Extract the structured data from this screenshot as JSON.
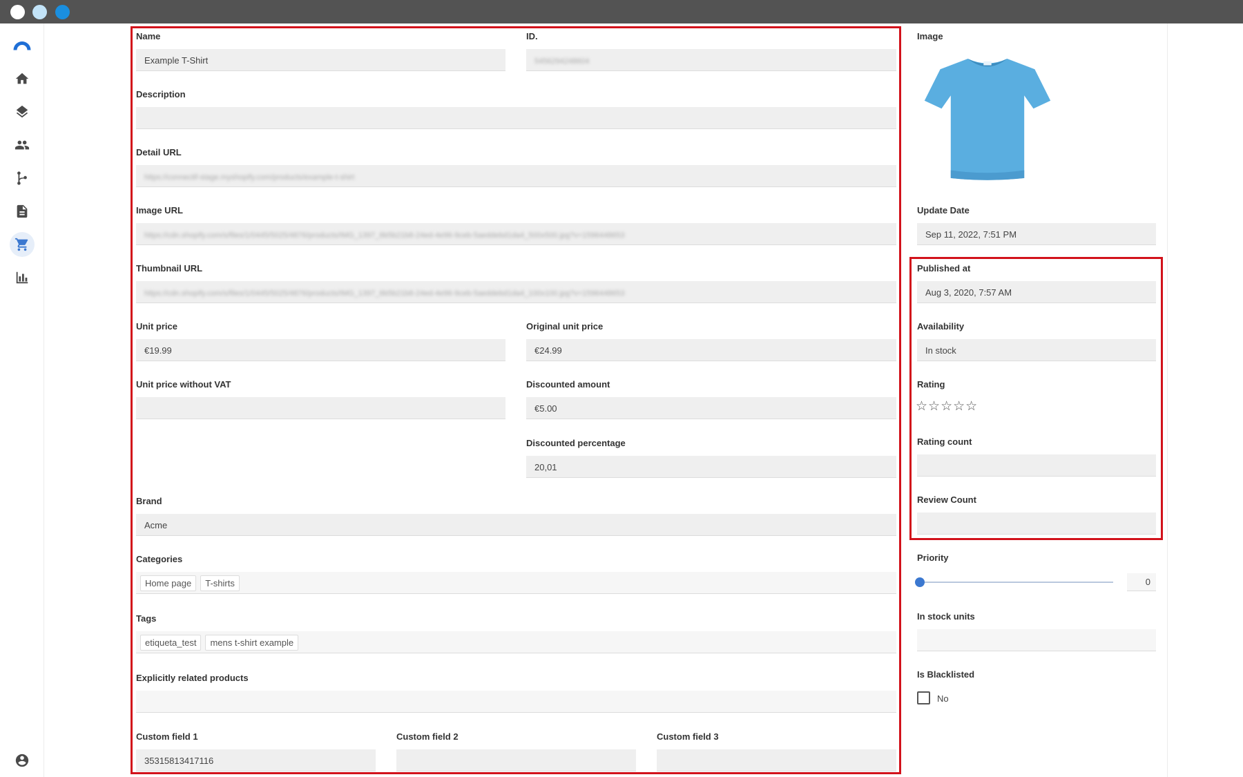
{
  "window": {
    "colors": {
      "titlebar": "#535353",
      "accent": "#3b78d0",
      "highlight": "#d2121b"
    }
  },
  "sidebar": {
    "items": [
      {
        "name": "logo",
        "icon": "brand-logo"
      },
      {
        "name": "home",
        "icon": "home-icon"
      },
      {
        "name": "layers",
        "icon": "layers-icon"
      },
      {
        "name": "contacts",
        "icon": "people-icon"
      },
      {
        "name": "flows",
        "icon": "branch-icon"
      },
      {
        "name": "documents",
        "icon": "document-icon"
      },
      {
        "name": "products",
        "icon": "cart-icon",
        "active": true
      },
      {
        "name": "analytics",
        "icon": "bar-chart-icon"
      },
      {
        "name": "account",
        "icon": "account-icon"
      }
    ]
  },
  "form": {
    "name": {
      "label": "Name",
      "value": "Example T-Shirt"
    },
    "id": {
      "label": "ID.",
      "value": "5456294248604"
    },
    "description": {
      "label": "Description",
      "value": ""
    },
    "detail_url": {
      "label": "Detail URL",
      "value": "https://connectif-stage.myshopify.com/products/example-t-shirt"
    },
    "image_url": {
      "label": "Image URL",
      "value": "https://cdn.shopify.com/s/files/1/0445/5025/4876/products/IMG_1397_6b5b21b8-24ed-4e96-9ceb-5aeddebd1da4_500x500.jpg?v=1596448653"
    },
    "thumbnail_url": {
      "label": "Thumbnail URL",
      "value": "https://cdn.shopify.com/s/files/1/0445/5025/4876/products/IMG_1397_6b5b21b8-24ed-4e96-9ceb-5aeddebd1da4_100x100.jpg?v=1596448653"
    },
    "unit_price": {
      "label": "Unit price",
      "value": "€19.99"
    },
    "original_unit_price": {
      "label": "Original unit price",
      "value": "€24.99"
    },
    "unit_price_no_vat": {
      "label": "Unit price without VAT",
      "value": ""
    },
    "discounted_amount": {
      "label": "Discounted amount",
      "value": "€5.00"
    },
    "discounted_percentage": {
      "label": "Discounted percentage",
      "value": "20,01"
    },
    "brand": {
      "label": "Brand",
      "value": "Acme"
    },
    "categories": {
      "label": "Categories",
      "items": [
        "Home page",
        "T-shirts"
      ]
    },
    "tags": {
      "label": "Tags",
      "items": [
        "etiqueta_test",
        "mens t-shirt example"
      ]
    },
    "related": {
      "label": "Explicitly related products",
      "value": ""
    },
    "custom1": {
      "label": "Custom field 1",
      "value": "35315813417116"
    },
    "custom2": {
      "label": "Custom field 2",
      "value": ""
    },
    "custom3": {
      "label": "Custom field 3",
      "value": ""
    }
  },
  "side": {
    "image": {
      "label": "Image",
      "icon": "tshirt-image",
      "color": "#5aaee0"
    },
    "update_date": {
      "label": "Update Date",
      "value": "Sep 11, 2022, 7:51 PM"
    },
    "published_at": {
      "label": "Published at",
      "value": "Aug 3, 2020, 7:57 AM"
    },
    "availability": {
      "label": "Availability",
      "value": "In stock"
    },
    "rating": {
      "label": "Rating",
      "stars": "☆☆☆☆☆",
      "value": 0,
      "max": 5
    },
    "rating_count": {
      "label": "Rating count",
      "value": ""
    },
    "review_count": {
      "label": "Review Count",
      "value": ""
    },
    "priority": {
      "label": "Priority",
      "value": "0"
    },
    "in_stock_units": {
      "label": "In stock units",
      "value": ""
    },
    "blacklisted": {
      "label": "Is Blacklisted",
      "value": "No"
    }
  }
}
